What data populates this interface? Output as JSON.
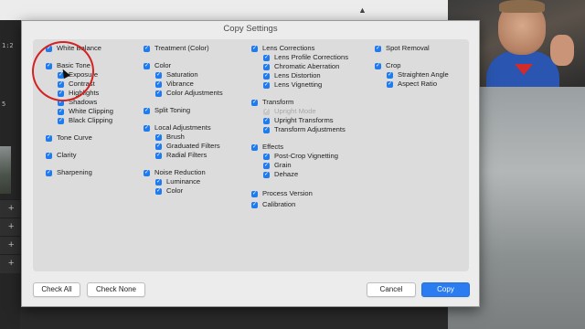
{
  "background": {
    "topbar_glyph": "▲",
    "left_numbers": [
      "1:2",
      "5"
    ],
    "plus_glyph": "+"
  },
  "dialog": {
    "title": "Copy Settings",
    "columns": [
      {
        "items": [
          {
            "label": "White Balance",
            "checked": true,
            "indent": 0
          },
          {
            "label": "Basic Tone",
            "checked": true,
            "indent": 0
          },
          {
            "label": "Exposure",
            "checked": true,
            "indent": 1
          },
          {
            "label": "Contrast",
            "checked": true,
            "indent": 1
          },
          {
            "label": "Highlights",
            "checked": true,
            "indent": 1
          },
          {
            "label": "Shadows",
            "checked": true,
            "indent": 1
          },
          {
            "label": "White Clipping",
            "checked": true,
            "indent": 1
          },
          {
            "label": "Black Clipping",
            "checked": true,
            "indent": 1
          },
          {
            "label": "Tone Curve",
            "checked": true,
            "indent": 0
          },
          {
            "label": "Clarity",
            "checked": true,
            "indent": 0
          },
          {
            "label": "Sharpening",
            "checked": true,
            "indent": 0
          }
        ]
      },
      {
        "items": [
          {
            "label": "Treatment (Color)",
            "checked": true,
            "indent": 0
          },
          {
            "label": "Color",
            "checked": true,
            "indent": 0
          },
          {
            "label": "Saturation",
            "checked": true,
            "indent": 1
          },
          {
            "label": "Vibrance",
            "checked": true,
            "indent": 1
          },
          {
            "label": "Color Adjustments",
            "checked": true,
            "indent": 1
          },
          {
            "label": "Split Toning",
            "checked": true,
            "indent": 0
          },
          {
            "label": "Local Adjustments",
            "checked": true,
            "indent": 0
          },
          {
            "label": "Brush",
            "checked": true,
            "indent": 1
          },
          {
            "label": "Graduated Filters",
            "checked": true,
            "indent": 1
          },
          {
            "label": "Radial Filters",
            "checked": true,
            "indent": 1
          },
          {
            "label": "Noise Reduction",
            "checked": true,
            "indent": 0
          },
          {
            "label": "Luminance",
            "checked": true,
            "indent": 1
          },
          {
            "label": "Color",
            "checked": true,
            "indent": 1
          }
        ]
      },
      {
        "items": [
          {
            "label": "Lens Corrections",
            "checked": true,
            "indent": 0
          },
          {
            "label": "Lens Profile Corrections",
            "checked": true,
            "indent": 1
          },
          {
            "label": "Chromatic Aberration",
            "checked": true,
            "indent": 1
          },
          {
            "label": "Lens Distortion",
            "checked": true,
            "indent": 1
          },
          {
            "label": "Lens Vignetting",
            "checked": true,
            "indent": 1
          },
          {
            "label": "Transform",
            "checked": true,
            "indent": 0
          },
          {
            "label": "Upright Mode",
            "checked": true,
            "indent": 1,
            "disabled": true
          },
          {
            "label": "Upright Transforms",
            "checked": true,
            "indent": 1
          },
          {
            "label": "Transform Adjustments",
            "checked": true,
            "indent": 1
          },
          {
            "label": "Effects",
            "checked": true,
            "indent": 0
          },
          {
            "label": "Post-Crop Vignetting",
            "checked": true,
            "indent": 1
          },
          {
            "label": "Grain",
            "checked": true,
            "indent": 1
          },
          {
            "label": "Dehaze",
            "checked": true,
            "indent": 1
          },
          {
            "label": "Process Version",
            "checked": true,
            "indent": 0
          },
          {
            "label": "Calibration",
            "checked": true,
            "indent": 0
          }
        ]
      },
      {
        "items": [
          {
            "label": "Spot Removal",
            "checked": true,
            "indent": 0
          },
          {
            "label": "Crop",
            "checked": true,
            "indent": 0
          },
          {
            "label": "Straighten Angle",
            "checked": true,
            "indent": 1
          },
          {
            "label": "Aspect Ratio",
            "checked": true,
            "indent": 1
          }
        ]
      }
    ],
    "buttons": {
      "check_all": "Check All",
      "check_none": "Check None",
      "cancel": "Cancel",
      "copy": "Copy"
    },
    "accent_color": "#1f7cf0"
  }
}
